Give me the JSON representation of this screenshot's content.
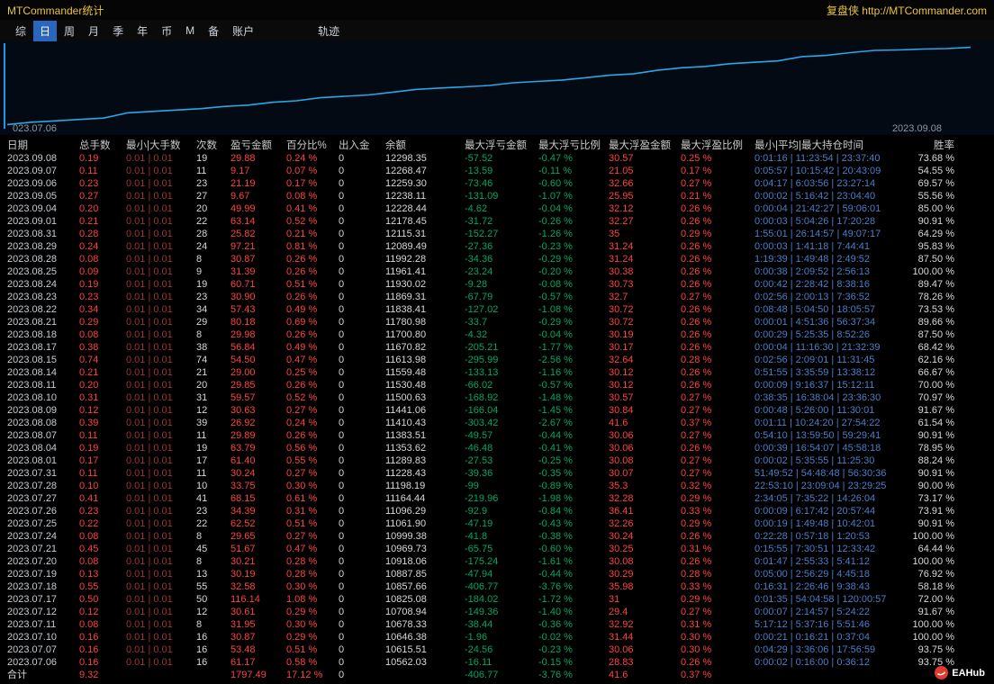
{
  "window": {
    "title": "MTCommander统计",
    "titlebar_right": "复盘侠 http://MTCommander.com"
  },
  "menu": {
    "items": [
      "综",
      "日",
      "周",
      "月",
      "季",
      "年",
      "币",
      "M",
      "备",
      "账户"
    ],
    "selected": "日",
    "trail_item": "轨迹"
  },
  "colors": {
    "background": "#000000",
    "gold": "#e9c43c",
    "menu": "#cdd5de",
    "menu_selected": "#2a66bd",
    "red": "#ff4141",
    "darkred": "#9c3434",
    "green": "#00a85f",
    "blue": "#4b7ec9",
    "text": "#d8d8d8",
    "dim": "#c6ccd2",
    "header": "#c9c9c9",
    "label": "#8f969d",
    "chart_line": "#2aa7e8",
    "axis": "#1a9ae6",
    "logo_red": "#e23b2e"
  },
  "chart_data": {
    "type": "line",
    "x_start_label": "023.07.06",
    "x_end_label": "2023.09.08",
    "x": [
      "2023.07.06",
      "2023.07.07",
      "2023.07.10",
      "2023.07.11",
      "2023.07.12",
      "2023.07.17",
      "2023.07.18",
      "2023.07.19",
      "2023.07.20",
      "2023.07.21",
      "2023.07.24",
      "2023.07.25",
      "2023.07.26",
      "2023.07.27",
      "2023.07.28",
      "2023.07.31",
      "2023.08.01",
      "2023.08.04",
      "2023.08.07",
      "2023.08.08",
      "2023.08.09",
      "2023.08.10",
      "2023.08.11",
      "2023.08.14",
      "2023.08.15",
      "2023.08.17",
      "2023.08.18",
      "2023.08.21",
      "2023.08.22",
      "2023.08.23",
      "2023.08.24",
      "2023.08.25",
      "2023.08.28",
      "2023.08.29",
      "2023.08.31",
      "2023.09.01",
      "2023.09.04",
      "2023.09.05",
      "2023.09.06",
      "2023.09.07",
      "2023.09.08"
    ],
    "series": [
      {
        "name": "余额",
        "values": [
          10562.03,
          10615.51,
          10646.38,
          10678.33,
          10708.94,
          10825.08,
          10857.66,
          10887.85,
          10918.06,
          10969.73,
          10999.38,
          11061.9,
          11096.29,
          11164.44,
          11198.19,
          11228.43,
          11289.83,
          11353.62,
          11383.51,
          11410.43,
          11441.06,
          11500.63,
          11530.48,
          11559.48,
          11613.98,
          11670.82,
          11700.8,
          11780.98,
          11838.41,
          11869.31,
          11930.02,
          11961.41,
          11992.28,
          12089.49,
          12115.31,
          12178.45,
          12228.44,
          12238.11,
          12259.3,
          12268.47,
          12298.35
        ]
      }
    ],
    "ylim": [
      10470,
      12350
    ],
    "line_color": "#2aa7e8",
    "grid": false,
    "legend": false
  },
  "table": {
    "columns": [
      {
        "label": "日期",
        "color": "dim"
      },
      {
        "label": "总手数",
        "color": "red"
      },
      {
        "label": "最小|大手数",
        "color": "darkred"
      },
      {
        "label": "次数",
        "color": "text"
      },
      {
        "label": "盈亏金额",
        "color": "red"
      },
      {
        "label": "百分比%",
        "color": "red"
      },
      {
        "label": "出入金",
        "color": "text"
      },
      {
        "label": "余额",
        "color": "text"
      },
      {
        "label": "最大浮亏金额",
        "color": "green"
      },
      {
        "label": "最大浮亏比例",
        "color": "green"
      },
      {
        "label": "最大浮盈金额",
        "color": "red"
      },
      {
        "label": "最大浮盈比例",
        "color": "red"
      },
      {
        "label": "最小|平均|最大持仓时间",
        "color": "blue"
      },
      {
        "label": "胜率",
        "color": "text"
      }
    ],
    "rows": [
      [
        "2023.09.08",
        "0.19",
        "0.01 | 0.01",
        "19",
        "29.88",
        "0.24 %",
        "0",
        "12298.35",
        "-57.52",
        "-0.47 %",
        "30.57",
        "0.25 %",
        "0:01:16 | 11:23:54 | 23:37:40",
        "73.68 %"
      ],
      [
        "2023.09.07",
        "0.11",
        "0.01 | 0.01",
        "11",
        "9.17",
        "0.07 %",
        "0",
        "12268.47",
        "-13.59",
        "-0.11 %",
        "21.05",
        "0.17 %",
        "0:05:57 | 10:15:42 | 20:43:09",
        "54.55 %"
      ],
      [
        "2023.09.06",
        "0.23",
        "0.01 | 0.01",
        "23",
        "21.19",
        "0.17 %",
        "0",
        "12259.30",
        "-73.46",
        "-0.60 %",
        "32.66",
        "0.27 %",
        "0:04:17 | 6:03:56 | 23:27:14",
        "69.57 %"
      ],
      [
        "2023.09.05",
        "0.27",
        "0.01 | 0.01",
        "27",
        "9.67",
        "0.08 %",
        "0",
        "12238.11",
        "-131.09",
        "-1.07 %",
        "25.95",
        "0.21 %",
        "0:00:02 | 5:16:42 | 23:04:40",
        "55.56 %"
      ],
      [
        "2023.09.04",
        "0.20",
        "0.01 | 0.01",
        "20",
        "49.99",
        "0.41 %",
        "0",
        "12228.44",
        "-4.62",
        "-0.04 %",
        "32.12",
        "0.26 %",
        "0:00:04 | 21:42:27 | 59:06:01",
        "85.00 %"
      ],
      [
        "2023.09.01",
        "0.21",
        "0.01 | 0.01",
        "22",
        "63.14",
        "0.52 %",
        "0",
        "12178.45",
        "-31.72",
        "-0.26 %",
        "32.27",
        "0.26 %",
        "0:00:03 | 5:04:26 | 17:20:28",
        "90.91 %"
      ],
      [
        "2023.08.31",
        "0.28",
        "0.01 | 0.01",
        "28",
        "25.82",
        "0.21 %",
        "0",
        "12115.31",
        "-152.27",
        "-1.26 %",
        "35",
        "0.29 %",
        "1:55:01 | 26:14:57 | 49:07:17",
        "64.29 %"
      ],
      [
        "2023.08.29",
        "0.24",
        "0.01 | 0.01",
        "24",
        "97.21",
        "0.81 %",
        "0",
        "12089.49",
        "-27.36",
        "-0.23 %",
        "31.24",
        "0.26 %",
        "0:00:03 | 1:41:18 | 7:44:41",
        "95.83 %"
      ],
      [
        "2023.08.28",
        "0.08",
        "0.01 | 0.01",
        "8",
        "30.87",
        "0.26 %",
        "0",
        "11992.28",
        "-34.36",
        "-0.29 %",
        "31.24",
        "0.26 %",
        "1:19:39 | 1:49:48 | 2:49:52",
        "87.50 %"
      ],
      [
        "2023.08.25",
        "0.09",
        "0.01 | 0.01",
        "9",
        "31.39",
        "0.26 %",
        "0",
        "11961.41",
        "-23.24",
        "-0.20 %",
        "30.38",
        "0.26 %",
        "0:00:38 | 2:09:52 | 2:56:13",
        "100.00 %"
      ],
      [
        "2023.08.24",
        "0.19",
        "0.01 | 0.01",
        "19",
        "60.71",
        "0.51 %",
        "0",
        "11930.02",
        "-9.28",
        "-0.08 %",
        "30.73",
        "0.26 %",
        "0:00:42 | 2:28:42 | 8:38:16",
        "89.47 %"
      ],
      [
        "2023.08.23",
        "0.23",
        "0.01 | 0.01",
        "23",
        "30.90",
        "0.26 %",
        "0",
        "11869.31",
        "-67.79",
        "-0.57 %",
        "32.7",
        "0.27 %",
        "0:02:56 | 2:00:13 | 7:36:52",
        "78.26 %"
      ],
      [
        "2023.08.22",
        "0.34",
        "0.01 | 0.01",
        "34",
        "57.43",
        "0.49 %",
        "0",
        "11838.41",
        "-127.02",
        "-1.08 %",
        "30.72",
        "0.26 %",
        "0:08:48 | 5:04:50 | 18:05:57",
        "73.53 %"
      ],
      [
        "2023.08.21",
        "0.29",
        "0.01 | 0.01",
        "29",
        "80.18",
        "0.69 %",
        "0",
        "11780.98",
        "-33.7",
        "-0.29 %",
        "30.72",
        "0.26 %",
        "0:00:01 | 4:51:36 | 56:37:34",
        "89.66 %"
      ],
      [
        "2023.08.18",
        "0.08",
        "0.01 | 0.01",
        "8",
        "29.98",
        "0.26 %",
        "0",
        "11700.80",
        "-4.32",
        "-0.04 %",
        "30.19",
        "0.26 %",
        "0:00:29 | 5:25:35 | 8:52:26",
        "87.50 %"
      ],
      [
        "2023.08.17",
        "0.38",
        "0.01 | 0.01",
        "38",
        "56.84",
        "0.49 %",
        "0",
        "11670.82",
        "-205.21",
        "-1.77 %",
        "30.17",
        "0.26 %",
        "0:00:04 | 11:16:30 | 21:32:39",
        "68.42 %"
      ],
      [
        "2023.08.15",
        "0.74",
        "0.01 | 0.01",
        "74",
        "54.50",
        "0.47 %",
        "0",
        "11613.98",
        "-295.99",
        "-2.56 %",
        "32.64",
        "0.28 %",
        "0:02:56 | 2:09:01 | 11:31:45",
        "62.16 %"
      ],
      [
        "2023.08.14",
        "0.21",
        "0.01 | 0.01",
        "21",
        "29.00",
        "0.25 %",
        "0",
        "11559.48",
        "-133.13",
        "-1.16 %",
        "30.12",
        "0.26 %",
        "0:51:55 | 3:35:59 | 13:38:12",
        "66.67 %"
      ],
      [
        "2023.08.11",
        "0.20",
        "0.01 | 0.01",
        "20",
        "29.85",
        "0.26 %",
        "0",
        "11530.48",
        "-66.02",
        "-0.57 %",
        "30.12",
        "0.26 %",
        "0:00:09 | 9:16:37 | 15:12:11",
        "70.00 %"
      ],
      [
        "2023.08.10",
        "0.31",
        "0.01 | 0.01",
        "31",
        "59.57",
        "0.52 %",
        "0",
        "11500.63",
        "-168.92",
        "-1.48 %",
        "30.57",
        "0.27 %",
        "0:38:35 | 16:38:04 | 23:36:30",
        "70.97 %"
      ],
      [
        "2023.08.09",
        "0.12",
        "0.01 | 0.01",
        "12",
        "30.63",
        "0.27 %",
        "0",
        "11441.06",
        "-166.04",
        "-1.45 %",
        "30.84",
        "0.27 %",
        "0:00:48 | 5:26:00 | 11:30:01",
        "91.67 %"
      ],
      [
        "2023.08.08",
        "0.39",
        "0.01 | 0.01",
        "39",
        "26.92",
        "0.24 %",
        "0",
        "11410.43",
        "-303.42",
        "-2.67 %",
        "41.6",
        "0.37 %",
        "0:01:11 | 10:24:20 | 27:54:22",
        "61.54 %"
      ],
      [
        "2023.08.07",
        "0.11",
        "0.01 | 0.01",
        "11",
        "29.89",
        "0.26 %",
        "0",
        "11383.51",
        "-49.57",
        "-0.44 %",
        "30.06",
        "0.27 %",
        "0:54:10 | 13:59:50 | 59:29:41",
        "90.91 %"
      ],
      [
        "2023.08.04",
        "0.19",
        "0.01 | 0.01",
        "19",
        "63.79",
        "0.56 %",
        "0",
        "11353.62",
        "-46.48",
        "-0.41 %",
        "30.06",
        "0.26 %",
        "0:00:39 | 16:54:07 | 45:58:18",
        "78.95 %"
      ],
      [
        "2023.08.01",
        "0.17",
        "0.01 | 0.01",
        "17",
        "61.40",
        "0.55 %",
        "0",
        "11289.83",
        "-27.53",
        "-0.25 %",
        "30.08",
        "0.27 %",
        "0:00:02 | 5:35:55 | 11:25:30",
        "88.24 %"
      ],
      [
        "2023.07.31",
        "0.11",
        "0.01 | 0.01",
        "11",
        "30.24",
        "0.27 %",
        "0",
        "11228.43",
        "-39.36",
        "-0.35 %",
        "30.07",
        "0.27 %",
        "51:49:52 | 54:48:48 | 56:30:36",
        "90.91 %"
      ],
      [
        "2023.07.28",
        "0.10",
        "0.01 | 0.01",
        "10",
        "33.75",
        "0.30 %",
        "0",
        "11198.19",
        "-99",
        "-0.89 %",
        "35.3",
        "0.32 %",
        "22:53:10 | 23:09:04 | 23:29:25",
        "90.00 %"
      ],
      [
        "2023.07.27",
        "0.41",
        "0.01 | 0.01",
        "41",
        "68.15",
        "0.61 %",
        "0",
        "11164.44",
        "-219.96",
        "-1.98 %",
        "32.28",
        "0.29 %",
        "2:34:05 | 7:35:22 | 14:26:04",
        "73.17 %"
      ],
      [
        "2023.07.26",
        "0.23",
        "0.01 | 0.01",
        "23",
        "34.39",
        "0.31 %",
        "0",
        "11096.29",
        "-92.9",
        "-0.84 %",
        "36.41",
        "0.33 %",
        "0:00:09 | 6:17:42 | 20:57:44",
        "73.91 %"
      ],
      [
        "2023.07.25",
        "0.22",
        "0.01 | 0.01",
        "22",
        "62.52",
        "0.51 %",
        "0",
        "11061.90",
        "-47.19",
        "-0.43 %",
        "32.26",
        "0.29 %",
        "0:00:19 | 1:49:48 | 10:42:01",
        "90.91 %"
      ],
      [
        "2023.07.24",
        "0.08",
        "0.01 | 0.01",
        "8",
        "29.65",
        "0.27 %",
        "0",
        "10999.38",
        "-41.8",
        "-0.38 %",
        "30.24",
        "0.26 %",
        "0:22:28 | 0:57:18 | 1:20:53",
        "100.00 %"
      ],
      [
        "2023.07.21",
        "0.45",
        "0.01 | 0.01",
        "45",
        "51.67",
        "0.47 %",
        "0",
        "10969.73",
        "-65.75",
        "-0.60 %",
        "30.25",
        "0.31 %",
        "0:15:55 | 7:30:51 | 12:33:42",
        "64.44 %"
      ],
      [
        "2023.07.20",
        "0.08",
        "0.01 | 0.01",
        "8",
        "30.21",
        "0.28 %",
        "0",
        "10918.06",
        "-175.24",
        "-1.61 %",
        "30.08",
        "0.26 %",
        "0:01:47 | 2:55:33 | 5:41:12",
        "100.00 %"
      ],
      [
        "2023.07.19",
        "0.13",
        "0.01 | 0.01",
        "13",
        "30.19",
        "0.28 %",
        "0",
        "10887.85",
        "-47.94",
        "-0.44 %",
        "30.29",
        "0.28 %",
        "0:05:00 | 2:56:29 | 4:45:18",
        "76.92 %"
      ],
      [
        "2023.07.18",
        "0.55",
        "0.01 | 0.01",
        "55",
        "32.58",
        "0.30 %",
        "0",
        "10857.66",
        "-406.77",
        "-3.76 %",
        "35.98",
        "0.33 %",
        "0:16:31 | 2:26:46 | 9:38:43",
        "58.18 %"
      ],
      [
        "2023.07.17",
        "0.50",
        "0.01 | 0.01",
        "50",
        "116.14",
        "1.08 %",
        "0",
        "10825.08",
        "-184.02",
        "-1.72 %",
        "31",
        "0.29 %",
        "0:01:35 | 54:04:58 | 120:00:57",
        "72.00 %"
      ],
      [
        "2023.07.12",
        "0.12",
        "0.01 | 0.01",
        "12",
        "30.61",
        "0.29 %",
        "0",
        "10708.94",
        "-149.36",
        "-1.40 %",
        "29.4",
        "0.27 %",
        "0:00:07 | 2:14:57 | 5:24:22",
        "91.67 %"
      ],
      [
        "2023.07.11",
        "0.08",
        "0.01 | 0.01",
        "8",
        "31.95",
        "0.30 %",
        "0",
        "10678.33",
        "-38.44",
        "-0.36 %",
        "32.92",
        "0.31 %",
        "5:17:12 | 5:37:16 | 5:51:46",
        "100.00 %"
      ],
      [
        "2023.07.10",
        "0.16",
        "0.01 | 0.01",
        "16",
        "30.87",
        "0.29 %",
        "0",
        "10646.38",
        "-1.96",
        "-0.02 %",
        "31.44",
        "0.30 %",
        "0:00:21 | 0:16:21 | 0:37:04",
        "100.00 %"
      ],
      [
        "2023.07.07",
        "0.16",
        "0.01 | 0.01",
        "16",
        "53.48",
        "0.51 %",
        "0",
        "10615.51",
        "-24.56",
        "-0.23 %",
        "30.06",
        "0.30 %",
        "0:04:29 | 3:36:06 | 17:56:59",
        "93.75 %"
      ],
      [
        "2023.07.06",
        "0.16",
        "0.01 | 0.01",
        "16",
        "61.17",
        "0.58 %",
        "0",
        "10562.03",
        "-16.11",
        "-0.15 %",
        "28.83",
        "0.26 %",
        "0:00:02 | 0:16:00 | 0:36:12",
        "93.75 %"
      ]
    ],
    "total": [
      "合计",
      "9.32",
      "",
      "",
      "1797.49",
      "17.12 %",
      "0",
      "",
      "-406.77",
      "-3.76 %",
      "41.6",
      "0.37 %",
      "",
      ""
    ]
  },
  "logo": {
    "text": "EAHub"
  }
}
